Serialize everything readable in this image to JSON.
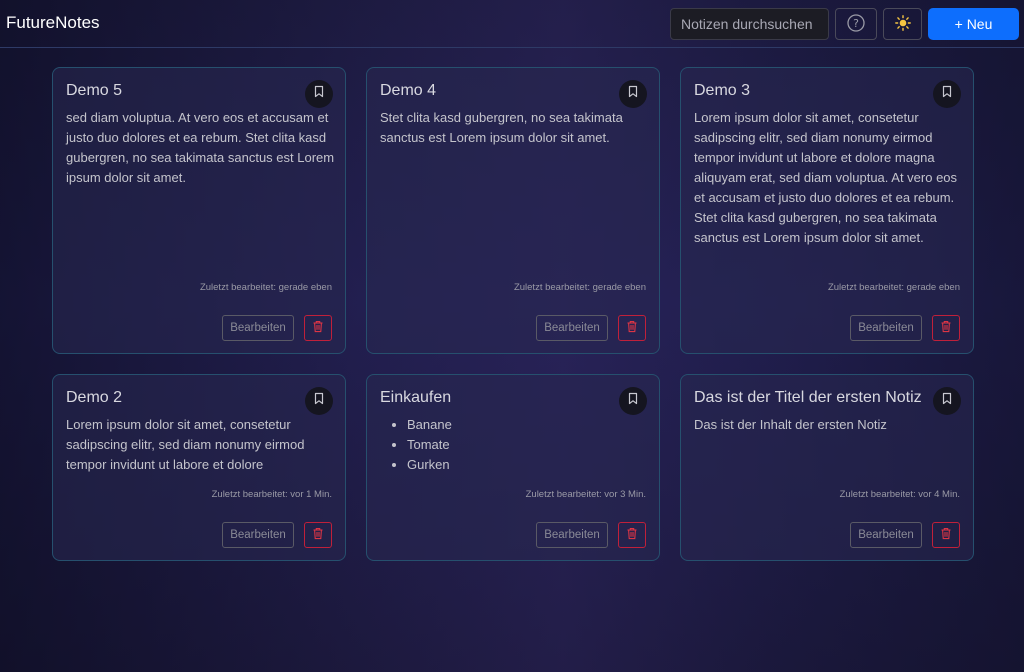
{
  "header": {
    "brand": "FutureNotes",
    "search_placeholder": "Notizen durchsuchen",
    "new_label": "+ Neu",
    "help_icon": "question-circle-icon",
    "theme_icon": "sun-icon"
  },
  "notes": [
    {
      "title": "Demo 5",
      "body": "sed diam voluptua. At vero eos et accusam et justo duo dolores et ea rebum. Stet clita kasd gubergren, no sea takimata sanctus est Lorem ipsum dolor sit amet.",
      "meta": "Zuletzt bearbeitet: gerade eben",
      "edit_label": "Bearbeiten"
    },
    {
      "title": "Demo 4",
      "body": "Stet clita kasd gubergren, no sea takimata sanctus est Lorem ipsum dolor sit amet.",
      "meta": "Zuletzt bearbeitet: gerade eben",
      "edit_label": "Bearbeiten"
    },
    {
      "title": "Demo 3",
      "body": "Lorem ipsum dolor sit amet, consetetur sadipscing elitr, sed diam nonumy eirmod tempor invidunt ut labore et dolore magna aliquyam erat, sed diam voluptua. At vero eos et accusam et justo duo dolores et ea rebum. Stet clita kasd gubergren, no sea takimata sanctus est Lorem ipsum dolor sit amet.",
      "meta": "Zuletzt bearbeitet: gerade eben",
      "edit_label": "Bearbeiten"
    },
    {
      "title": "Demo 2",
      "body": "Lorem ipsum dolor sit amet, consetetur sadipscing elitr, sed diam nonumy eirmod tempor invidunt ut labore et dolore",
      "meta": "Zuletzt bearbeitet: vor 1 Min.",
      "edit_label": "Bearbeiten"
    },
    {
      "title": "Einkaufen",
      "items": [
        "Banane",
        "Tomate",
        "Gurken"
      ],
      "meta": "Zuletzt bearbeitet: vor 3 Min.",
      "edit_label": "Bearbeiten"
    },
    {
      "title": "Das ist der Titel der ersten Notiz",
      "body": "Das ist der Inhalt der ersten Notiz",
      "meta": "Zuletzt bearbeitet: vor 4 Min.",
      "edit_label": "Bearbeiten"
    }
  ],
  "colors": {
    "accent": "#0d6efd",
    "danger": "#dc3545",
    "card_border": "#26506e"
  }
}
